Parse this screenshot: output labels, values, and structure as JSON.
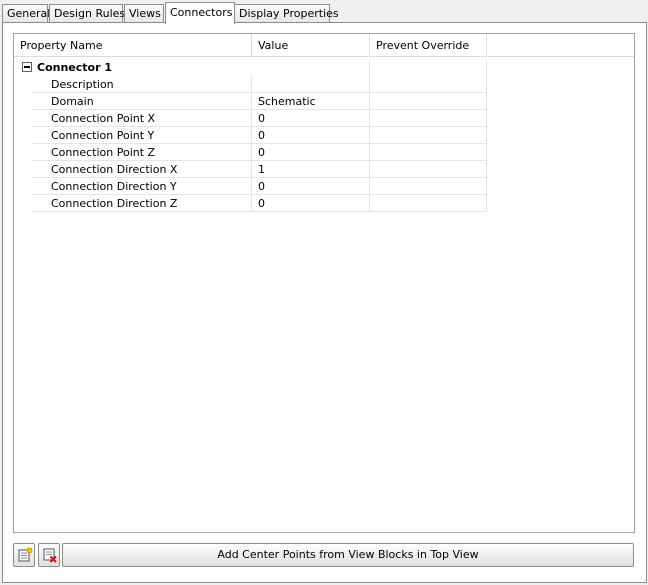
{
  "tabs": [
    {
      "label": "General"
    },
    {
      "label": "Design Rules"
    },
    {
      "label": "Views"
    },
    {
      "label": "Connectors"
    },
    {
      "label": "Display Properties"
    }
  ],
  "grid": {
    "headers": [
      "Property Name",
      "Value",
      "Prevent Override"
    ],
    "group": {
      "label": "Connector 1",
      "expanded": true
    },
    "rows": [
      {
        "name": "Description",
        "value": ""
      },
      {
        "name": "Domain",
        "value": "Schematic"
      },
      {
        "name": "Connection Point X",
        "value": "0"
      },
      {
        "name": "Connection Point Y",
        "value": "0"
      },
      {
        "name": "Connection Point Z",
        "value": "0"
      },
      {
        "name": "Connection Direction X",
        "value": "1"
      },
      {
        "name": "Connection Direction Y",
        "value": "0"
      },
      {
        "name": "Connection Direction Z",
        "value": "0"
      }
    ]
  },
  "footer": {
    "add_icon": "add-connector-icon",
    "delete_icon": "delete-connector-icon",
    "add_center_points_label": "Add Center Points from View Blocks in Top View"
  }
}
